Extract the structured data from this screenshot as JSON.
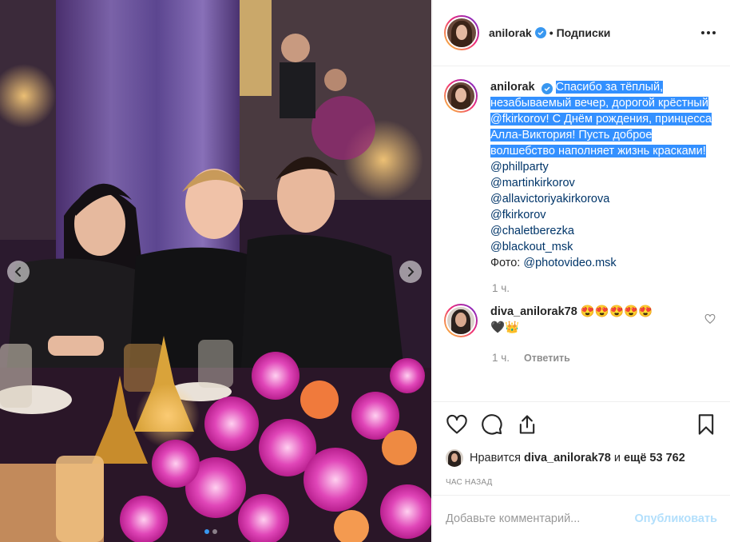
{
  "post": {
    "author": "anilorak",
    "follow_label": "Подписки",
    "caption_username": "anilorak",
    "caption_highlight_1": "Спасибо за тёплый, незабываемый вечер, дорогой крёстный",
    "caption_mention_inline": "@fkirkorov",
    "caption_highlight_2": "! С Днём рождения, принцесса Алла-Виктория! Пусть доброе волшебство наполняет жизнь красками!",
    "mentions": [
      "@phillparty",
      "@martinkirkorov",
      "@allavictoriyakirkorova",
      "@fkirkorov",
      "@chaletberezka",
      "@blackout_msk"
    ],
    "photo_credit_label": "Фото: ",
    "photo_credit_mention": "@photovideo.msk",
    "caption_time": "1 ч."
  },
  "reply": {
    "username": "diva_anilorak78",
    "text": "😍😍😍😍😍",
    "text_line2": "🖤👑",
    "time": "1 ч.",
    "reply_label": "Ответить"
  },
  "likes": {
    "prefix": "Нравится ",
    "user": "diva_anilorak78",
    "middle": " и ",
    "count": "ещё 53 762"
  },
  "posted_ago": "ЧАС НАЗАД",
  "comment_input": {
    "placeholder": "Добавьте комментарий..."
  },
  "publish_label": "Опубликовать",
  "carousel": {
    "slide_count": 2,
    "active_index": 0
  },
  "colors": {
    "verified": "#3897f0",
    "mention": "#003569",
    "selection": "#3390ff",
    "publish": "#b2dffc"
  },
  "icons": [
    "verified-icon",
    "more-icon",
    "chevron-left-icon",
    "chevron-right-icon",
    "heart-icon",
    "comment-icon",
    "share-icon",
    "bookmark-icon"
  ]
}
